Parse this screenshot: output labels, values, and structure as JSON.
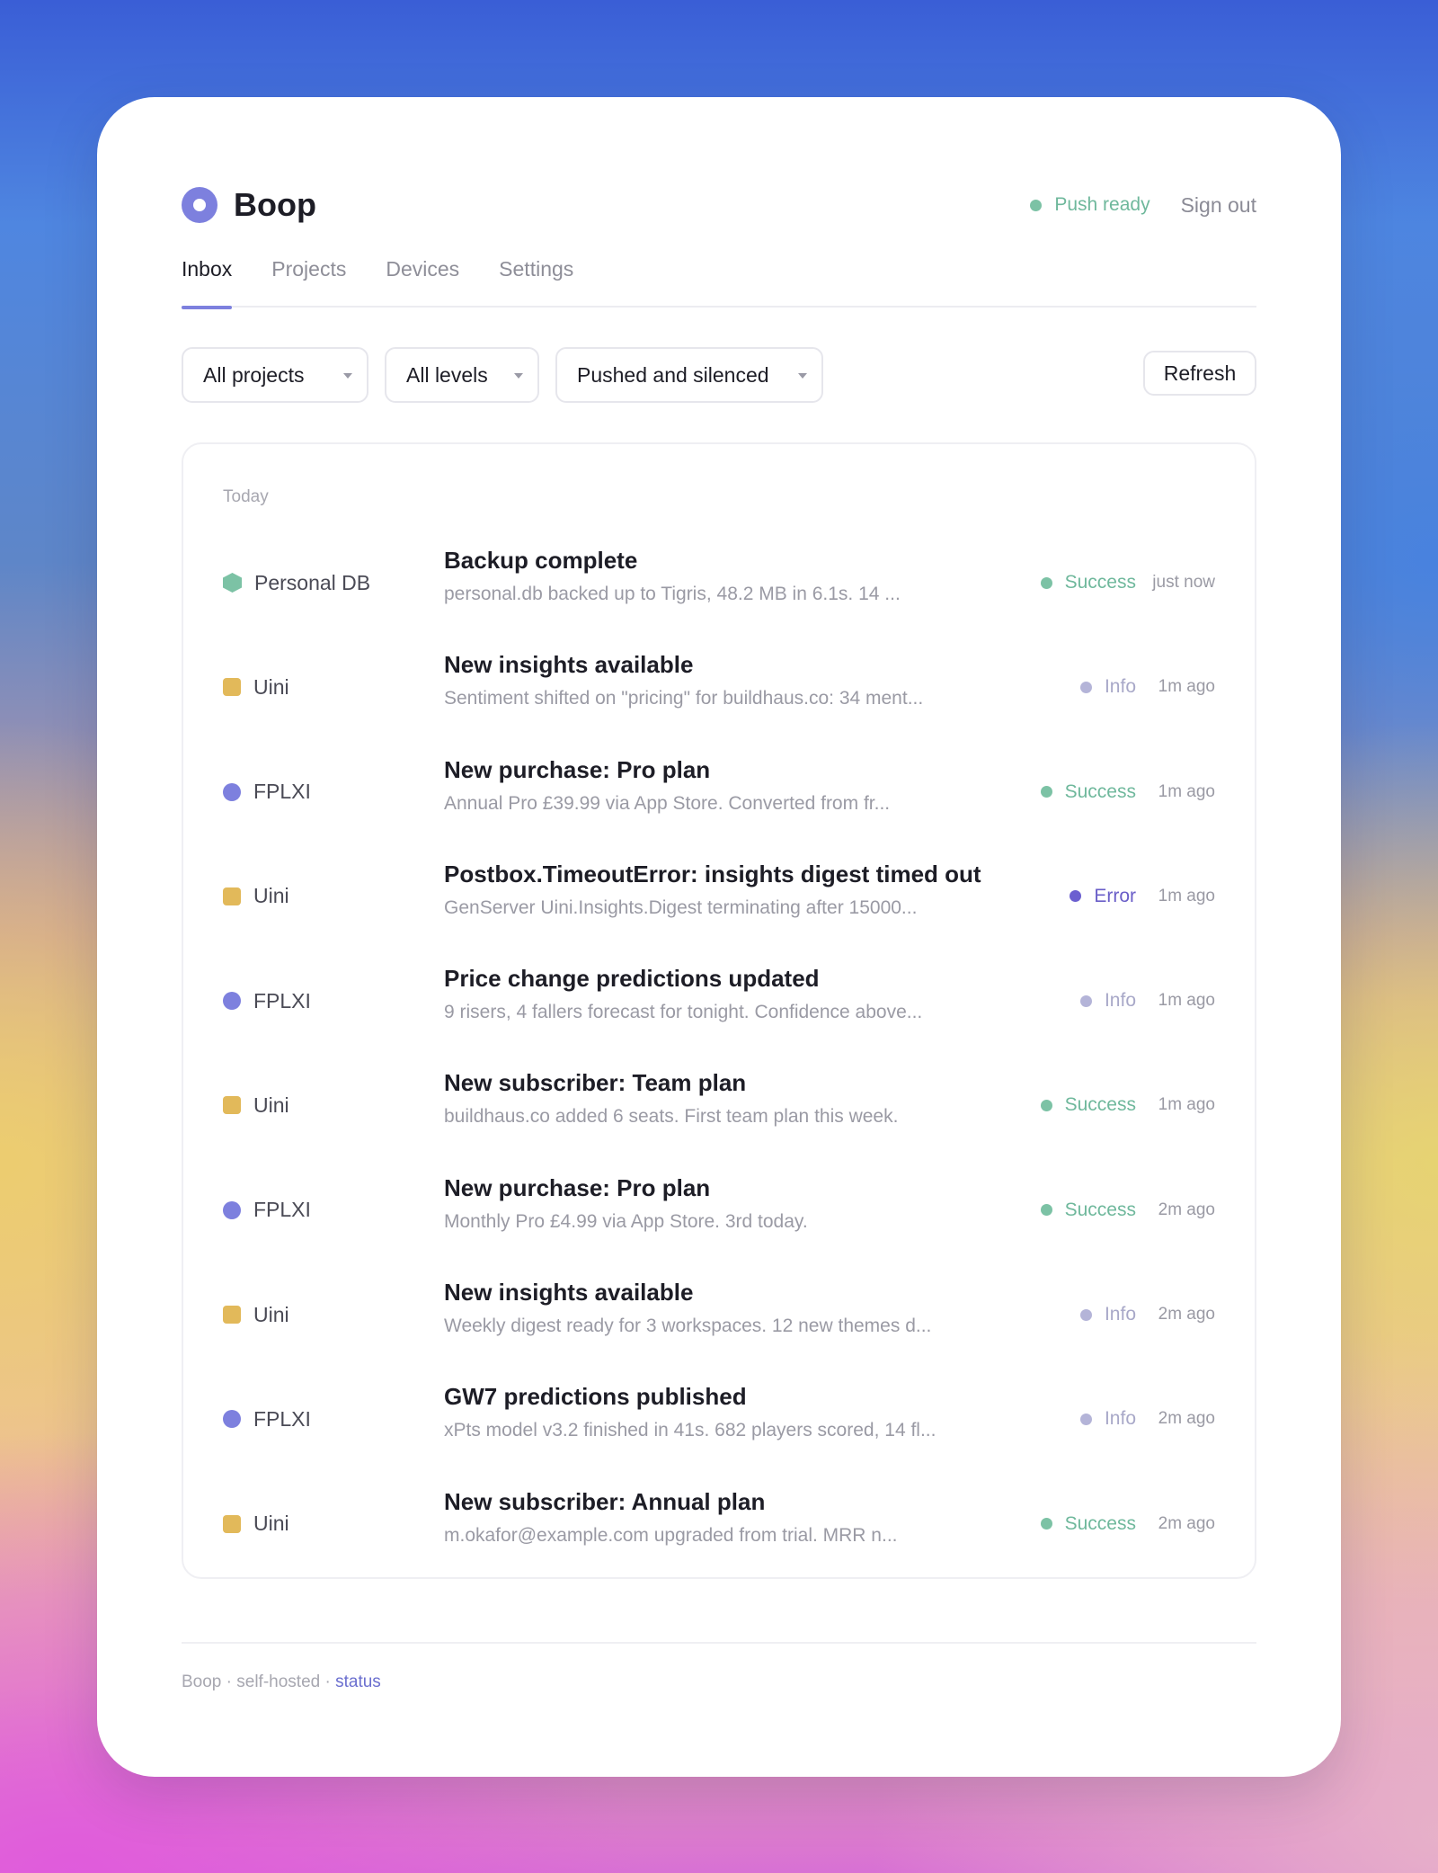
{
  "app": {
    "name": "Boop",
    "logo_icon": "ring-logo-icon"
  },
  "header": {
    "push_status": "Push ready",
    "sign_out": "Sign out"
  },
  "tabs": [
    {
      "label": "Inbox",
      "active": true
    },
    {
      "label": "Projects",
      "active": false
    },
    {
      "label": "Devices",
      "active": false
    },
    {
      "label": "Settings",
      "active": false
    }
  ],
  "filters": {
    "projects": "All projects",
    "levels": "All levels",
    "mode": "Pushed and silenced",
    "refresh": "Refresh"
  },
  "inbox": {
    "group_label": "Today",
    "rows": [
      {
        "project": "Personal DB",
        "project_icon": "hexagon",
        "title": "Backup complete",
        "body": "personal.db backed up to Tigris, 48.2 MB in 6.1s. 14 ...",
        "level": "Success",
        "time": "just now"
      },
      {
        "project": "Uini",
        "project_icon": "square",
        "title": "New insights available",
        "body": "Sentiment shifted on \"pricing\" for buildhaus.co: 34 ment...",
        "level": "Info",
        "time": "1m ago"
      },
      {
        "project": "FPLXI",
        "project_icon": "circle",
        "title": "New purchase: Pro plan",
        "body": "Annual Pro £39.99 via App Store. Converted from fr...",
        "level": "Success",
        "time": "1m ago"
      },
      {
        "project": "Uini",
        "project_icon": "square",
        "title": "Postbox.TimeoutError: insights digest timed out",
        "body": "GenServer Uini.Insights.Digest terminating after 15000...",
        "level": "Error",
        "time": "1m ago"
      },
      {
        "project": "FPLXI",
        "project_icon": "circle",
        "title": "Price change predictions updated",
        "body": "9 risers, 4 fallers forecast for tonight. Confidence above...",
        "level": "Info",
        "time": "1m ago"
      },
      {
        "project": "Uini",
        "project_icon": "square",
        "title": "New subscriber: Team plan",
        "body": "buildhaus.co added 6 seats. First team plan this week.",
        "level": "Success",
        "time": "1m ago"
      },
      {
        "project": "FPLXI",
        "project_icon": "circle",
        "title": "New purchase: Pro plan",
        "body": "Monthly Pro £4.99 via App Store. 3rd today.",
        "level": "Success",
        "time": "2m ago"
      },
      {
        "project": "Uini",
        "project_icon": "square",
        "title": "New insights available",
        "body": "Weekly digest ready for 3 workspaces. 12 new themes d...",
        "level": "Info",
        "time": "2m ago"
      },
      {
        "project": "FPLXI",
        "project_icon": "circle",
        "title": "GW7 predictions published",
        "body": "xPts model v3.2 finished in 41s. 682 players scored, 14 fl...",
        "level": "Info",
        "time": "2m ago"
      },
      {
        "project": "Uini",
        "project_icon": "square",
        "title": "New subscriber: Annual plan",
        "body": "m.okafor@example.com upgraded from trial. MRR n...",
        "level": "Success",
        "time": "2m ago"
      }
    ]
  },
  "footer": {
    "brand": "Boop",
    "sep1": " · ",
    "hosting": "self-hosted",
    "sep2": " · ",
    "status_link": "status"
  },
  "colors": {
    "accent": "#7d80de",
    "success": "#7cc2a5",
    "info": "#b4b4d8",
    "error": "#6b5fd0",
    "uini": "#e2b95a",
    "personal_db": "#7cc2a5",
    "fplxi": "#7d80de"
  }
}
